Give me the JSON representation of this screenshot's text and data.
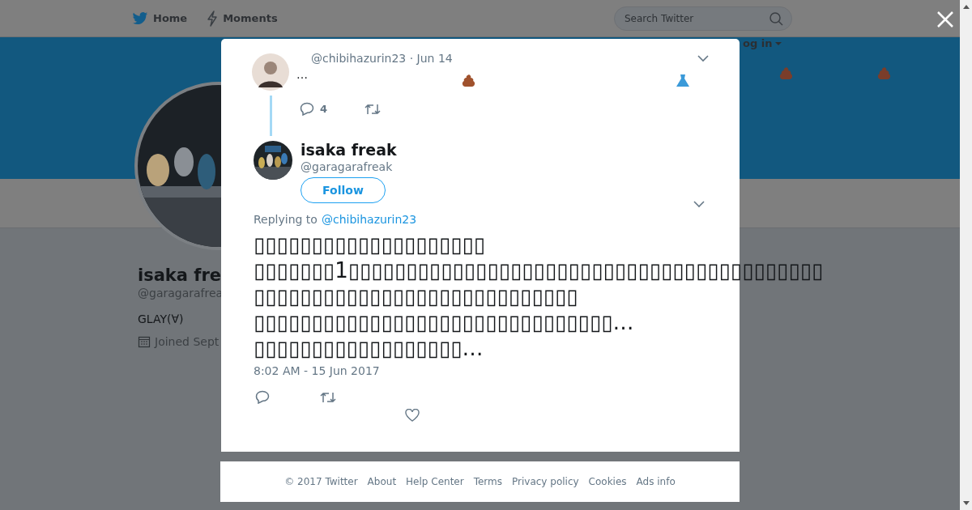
{
  "nav": {
    "items": [
      {
        "label": "Home",
        "kind": "bird"
      },
      {
        "label": "Moments",
        "kind": "bolt"
      }
    ],
    "search": {
      "placeholder": "Search Twitter"
    },
    "login": "og in"
  },
  "profile": {
    "name": "isaka fre",
    "handle": "@garagarafrea",
    "bio": "GLAY(∀)",
    "joined": "Joined Sept"
  },
  "parent_tweet": {
    "meta": "@chibihazurin23 · Jun 14",
    "text": "…",
    "reply_count": "4"
  },
  "tweet": {
    "name": "isaka freak",
    "handle": "@garagarafreak",
    "follow": "Follow",
    "replying_label": "Replying to",
    "replying_to": "@chibihazurin23",
    "lines": [
      "▯▯▯▯▯▯▯▯▯▯▯▯▯▯▯▯▯▯▯▯",
      "▯▯▯▯▯▯▯1▯▯▯▯▯▯▯▯▯▯▯▯▯▯▯▯▯▯▯▯▯▯▯▯▯▯▯▯▯▯▯▯▯▯▯▯▯▯▯▯▯",
      "▯▯▯▯▯▯▯▯▯▯▯▯▯▯▯▯▯▯▯▯▯▯▯▯▯▯▯▯",
      "▯▯▯▯▯▯▯▯▯▯▯▯▯▯▯▯▯▯▯▯▯▯▯▯▯▯▯▯▯▯▯…",
      "▯▯▯▯▯▯▯▯▯▯▯▯▯▯▯▯▯▯…"
    ],
    "timestamp": "8:02 AM - 15 Jun 2017"
  },
  "footer": [
    "© 2017 Twitter",
    "About",
    "Help Center",
    "Terms",
    "Privacy policy",
    "Cookies",
    "Ads info"
  ]
}
